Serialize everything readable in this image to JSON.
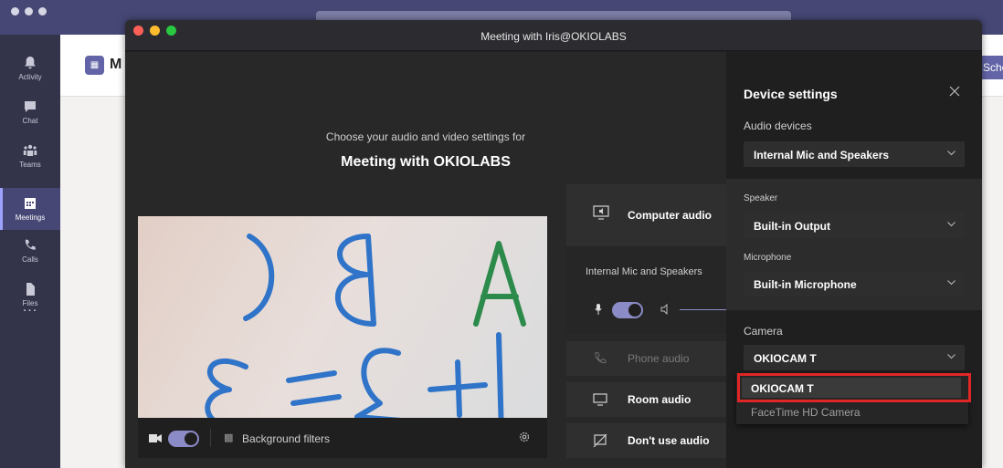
{
  "sidebar": {
    "items": [
      {
        "label": "Activity",
        "icon": "bell-icon",
        "active": false
      },
      {
        "label": "Chat",
        "icon": "chat-icon",
        "active": false
      },
      {
        "label": "Teams",
        "icon": "teams-icon",
        "active": false
      },
      {
        "label": "Meetings",
        "icon": "calendar-icon",
        "active": true
      },
      {
        "label": "Calls",
        "icon": "phone-icon",
        "active": false
      },
      {
        "label": "Files",
        "icon": "file-icon",
        "active": false
      }
    ],
    "more": "..."
  },
  "outer": {
    "header_initial": "M",
    "schedule_button": "Sched"
  },
  "meeting_window": {
    "title": "Meeting with Iris@OKIOLABS"
  },
  "prejoin": {
    "prompt": "Choose your audio and video settings for",
    "meeting_title": "Meeting with OKIOLABS",
    "background_filters": "Background filters"
  },
  "audio_options": {
    "computer_audio": "Computer audio",
    "current_device": "Internal Mic and Speakers",
    "phone_audio": "Phone audio",
    "room_audio": "Room audio",
    "dont_use_audio": "Don't use audio"
  },
  "device_settings": {
    "title": "Device settings",
    "audio_devices_label": "Audio devices",
    "audio_devices_value": "Internal Mic and Speakers",
    "speaker_label": "Speaker",
    "speaker_value": "Built-in Output",
    "microphone_label": "Microphone",
    "microphone_value": "Built-in Microphone",
    "camera_label": "Camera",
    "camera_value": "OKIOCAM T",
    "camera_options": [
      "OKIOCAM T",
      "FaceTime HD Camera"
    ]
  },
  "colors": {
    "accent": "#6264a7",
    "toggle": "#8b8cc7",
    "highlight": "#e02626"
  }
}
